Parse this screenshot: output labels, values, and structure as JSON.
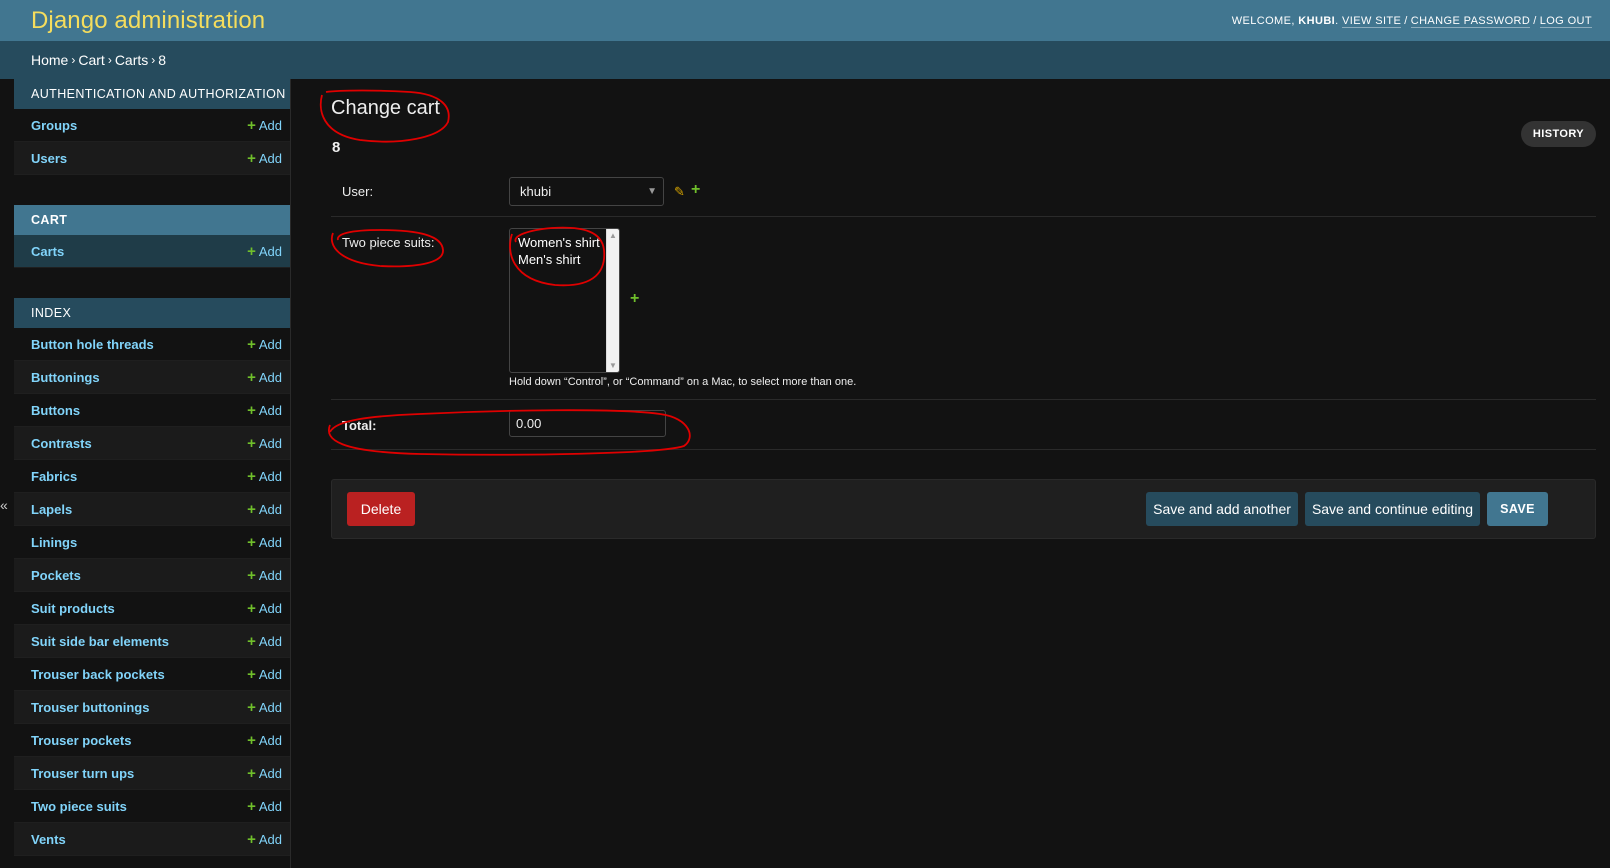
{
  "header": {
    "branding": "Django administration",
    "welcome": "WELCOME,",
    "username": "KHUBI",
    "view_site": "VIEW SITE",
    "change_password": "CHANGE PASSWORD",
    "log_out": "LOG OUT"
  },
  "breadcrumbs": [
    "Home",
    "Cart",
    "Carts",
    "8"
  ],
  "sidebar": {
    "toggle_icon": "«",
    "add_label": "Add",
    "modules": [
      {
        "caption": "AUTHENTICATION AND AUTHORIZATION",
        "models": [
          "Groups",
          "Users"
        ]
      },
      {
        "caption": "CART",
        "models": [
          "Carts"
        ]
      },
      {
        "caption": "INDEX",
        "models": [
          "Button hole threads",
          "Buttonings",
          "Buttons",
          "Contrasts",
          "Fabrics",
          "Lapels",
          "Linings",
          "Pockets",
          "Suit products",
          "Suit side bar elements",
          "Trouser back pockets",
          "Trouser buttonings",
          "Trouser pockets",
          "Trouser turn ups",
          "Two piece suits",
          "Vents"
        ]
      }
    ]
  },
  "content": {
    "title": "Change cart",
    "object_name": "8",
    "history": "HISTORY",
    "user": {
      "label": "User:",
      "value": "khubi"
    },
    "two_piece_suits": {
      "label": "Two piece suits:",
      "options": [
        "Women's shirt",
        "Men's shirt"
      ],
      "help": "Hold down “Control”, or “Command” on a Mac, to select more than one."
    },
    "total": {
      "label": "Total:",
      "value": "0.00"
    }
  },
  "submit_row": {
    "delete": "Delete",
    "save_add_another": "Save and add another",
    "save_continue": "Save and continue editing",
    "save": "SAVE"
  },
  "colors": {
    "header_bg": "#417690",
    "breadcrumbs_bg": "#264b5d",
    "branding": "#f5dd5d",
    "link": "#81d4fa",
    "add_plus": "#70bf2b",
    "delete_bg": "#ba2121",
    "annotation_red": "#e00000"
  },
  "icons": {
    "plus": "plus-icon",
    "edit": "pencil-icon",
    "dropdown": "chevron-down-icon",
    "sidebar_toggle": "double-chevron-left-icon"
  }
}
